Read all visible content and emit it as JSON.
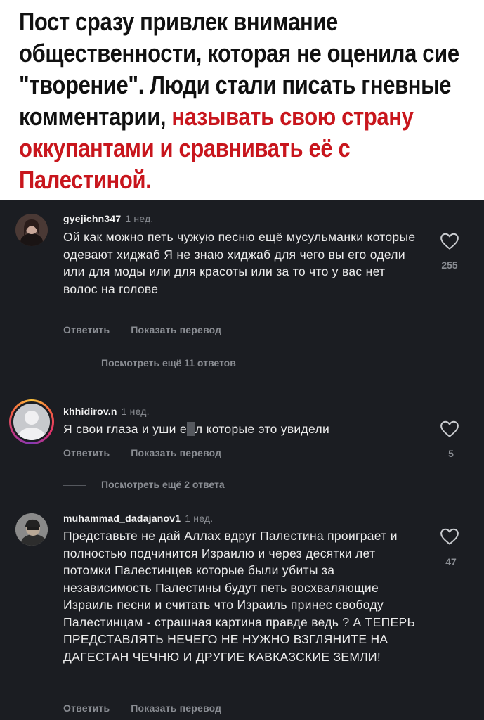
{
  "headline": {
    "black": "Пост сразу привлек внимание общественности, которая не оценила сие \"творение\". Люди стали писать гневные комментарии, ",
    "red": "называть свою страну оккупантами и сравнивать её с Палестиной."
  },
  "colors": {
    "background": "#1b1d22",
    "text": "#ececec",
    "muted": "#8a8d93",
    "accent_red": "#c8161d"
  },
  "comments": [
    {
      "username": "gyejichn347",
      "time": "1 нед.",
      "text": "Ой как можно петь чужую песню ещё мусульманки которые одевают хиджаб Я не знаю хиджаб для чего вы его одели или для моды или для красоты или за то что у вас нет волос на голове",
      "likes": "255",
      "reply": "Ответить",
      "translate": "Показать перевод",
      "view_replies": "Посмотреть ещё 11 ответов"
    },
    {
      "username": "khhidirov.n",
      "time": "1 нед.",
      "text": "Я свои глаза и уши е",
      "text_censored": "л",
      "text_end": " которые это увидели",
      "likes": "5",
      "reply": "Ответить",
      "translate": "Показать перевод",
      "view_replies": "Посмотреть ещё 2 ответа"
    },
    {
      "username": "muhammad_dadajanov1",
      "time": "1 нед.",
      "text": "Представьте не дай Аллах вдруг Палестина проиграет и полностью подчинится Израилю и через десятки лет потомки Палестинцев которые были убиты за независимость Палестины будут петь восхваляющие Израиль песни и считать что Израиль принес свободу Палестинцам - страшная картина правде ведь ? А ТЕПЕРЬ ПРЕДСТАВЛЯТЬ НЕЧЕГО НЕ НУЖНО ВЗГЛЯНИТЕ НА ДАГЕСТАН ЧЕЧНЮ И ДРУГИЕ КАВКАЗСКИЕ ЗЕМЛИ!",
      "likes": "47",
      "reply": "Ответить",
      "translate": "Показать перевод"
    }
  ]
}
